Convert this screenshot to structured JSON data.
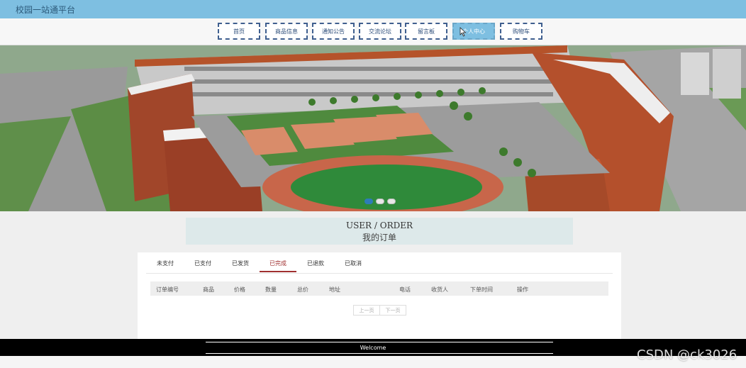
{
  "header": {
    "site_title": "校园一站通平台"
  },
  "nav": {
    "items": [
      {
        "label": "首页"
      },
      {
        "label": "商品信息"
      },
      {
        "label": "通知公告"
      },
      {
        "label": "交流论坛"
      },
      {
        "label": "留言板"
      },
      {
        "label": "个人中心",
        "active": true
      },
      {
        "label": "购物车"
      }
    ]
  },
  "carousel": {
    "slides": 3,
    "active_index": 0
  },
  "section": {
    "title_en": "USER / ORDER",
    "title_cn": "我的订单"
  },
  "order_tabs": [
    {
      "label": "未支付"
    },
    {
      "label": "已支付"
    },
    {
      "label": "已发货"
    },
    {
      "label": "已完成",
      "active": true
    },
    {
      "label": "已退款"
    },
    {
      "label": "已取消"
    }
  ],
  "table": {
    "columns": [
      "订单编号",
      "商品",
      "价格",
      "数量",
      "总价",
      "地址",
      "电话",
      "收货人",
      "下单时间",
      "操作"
    ],
    "rows": []
  },
  "pagination": {
    "prev_label": "上一页",
    "next_label": "下一页"
  },
  "footer": {
    "text": "Welcome"
  },
  "watermark": "CSDN @ck3026",
  "colors": {
    "topbar": "#7ebfe1",
    "active_tab": "#a03030",
    "footer": "#000000"
  }
}
